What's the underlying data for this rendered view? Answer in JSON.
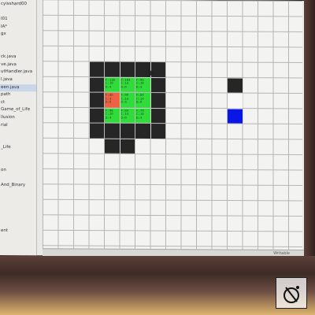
{
  "sidebar": {
    "items": [
      {
        "label": "cyisshard00",
        "selected": false
      },
      {
        "label": "",
        "selected": false
      },
      {
        "label": "I01",
        "selected": false
      },
      {
        "label": "IA*",
        "selected": false
      },
      {
        "label": "gx",
        "selected": false
      },
      {
        "label": "",
        "selected": false
      },
      {
        "label": "",
        "selected": false
      },
      {
        "label": "ck.java",
        "selected": false
      },
      {
        "label": "ve.java",
        "selected": false
      },
      {
        "label": "utHandler.java",
        "selected": false
      },
      {
        "label": "l.java",
        "selected": false
      },
      {
        "label": "een.java",
        "selected": true
      },
      {
        "label": "path",
        "selected": false
      },
      {
        "label": "ct",
        "selected": false
      },
      {
        "label": "Game_of_Life",
        "selected": false
      },
      {
        "label": "llusion",
        "selected": false
      },
      {
        "label": "rial",
        "selected": false
      },
      {
        "label": "",
        "selected": false
      },
      {
        "label": "",
        "selected": false
      },
      {
        "label": "_Life",
        "selected": false
      },
      {
        "label": "",
        "selected": false
      },
      {
        "label": "",
        "selected": false
      },
      {
        "label": "on",
        "selected": false
      },
      {
        "label": "",
        "selected": false
      },
      {
        "label": "And_Binary",
        "selected": false
      },
      {
        "label": "",
        "selected": false
      },
      {
        "label": "",
        "selected": false
      },
      {
        "label": "",
        "selected": false
      },
      {
        "label": "",
        "selected": false
      },
      {
        "label": "",
        "selected": false
      },
      {
        "label": "ent",
        "selected": false
      },
      {
        "label": "",
        "selected": false
      },
      {
        "label": "",
        "selected": false
      }
    ]
  },
  "grid": {
    "cells": [
      {
        "kind": "dark",
        "row": 4,
        "col": 3,
        "label": ""
      },
      {
        "kind": "dark",
        "row": 4,
        "col": 4,
        "label": ""
      },
      {
        "kind": "dark",
        "row": 4,
        "col": 5,
        "label": ""
      },
      {
        "kind": "dark",
        "row": 4,
        "col": 6,
        "label": ""
      },
      {
        "kind": "dark",
        "row": 4,
        "col": 7,
        "label": ""
      },
      {
        "kind": "dark",
        "row": 5,
        "col": 3,
        "label": ""
      },
      {
        "kind": "green",
        "row": 5,
        "col": 4,
        "label": "F:138\nC:10\nD:4"
      },
      {
        "kind": "green",
        "row": 5,
        "col": 5,
        "label": "F:104\nC:14\nD:0"
      },
      {
        "kind": "green",
        "row": 5,
        "col": 6,
        "label": "F:96\nC:10\nD:4"
      },
      {
        "kind": "dark",
        "row": 5,
        "col": 7,
        "label": ""
      },
      {
        "kind": "dark",
        "row": 6,
        "col": 3,
        "label": ""
      },
      {
        "kind": "red",
        "row": 6,
        "col": 4,
        "label": "F:86\nC:4\nD:0"
      },
      {
        "kind": "green",
        "row": 6,
        "col": 5,
        "label": "F:90\nC:14\nD:4"
      },
      {
        "kind": "green",
        "row": 6,
        "col": 6,
        "label": "F:84\nC:14\nD:0"
      },
      {
        "kind": "dark",
        "row": 6,
        "col": 7,
        "label": ""
      },
      {
        "kind": "dark",
        "row": 7,
        "col": 3,
        "label": ""
      },
      {
        "kind": "green",
        "row": 7,
        "col": 4,
        "label": "F:96\nC:20\nD:4"
      },
      {
        "kind": "green",
        "row": 7,
        "col": 5,
        "label": "F:84\nC:14\nD:0"
      },
      {
        "kind": "green",
        "row": 7,
        "col": 6,
        "label": "F:70\nC:18\nD:4"
      },
      {
        "kind": "dark",
        "row": 7,
        "col": 7,
        "label": ""
      },
      {
        "kind": "dark",
        "row": 8,
        "col": 3,
        "label": ""
      },
      {
        "kind": "dark",
        "row": 8,
        "col": 4,
        "label": ""
      },
      {
        "kind": "dark",
        "row": 8,
        "col": 5,
        "label": ""
      },
      {
        "kind": "dark",
        "row": 8,
        "col": 6,
        "label": ""
      },
      {
        "kind": "dark",
        "row": 8,
        "col": 7,
        "label": ""
      },
      {
        "kind": "dark",
        "row": 9,
        "col": 4,
        "label": ""
      },
      {
        "kind": "dark",
        "row": 9,
        "col": 5,
        "label": ""
      },
      {
        "kind": "dark",
        "row": 5,
        "col": 12,
        "label": ""
      },
      {
        "kind": "white",
        "row": 6,
        "col": 12,
        "label": ""
      },
      {
        "kind": "blue",
        "row": 7,
        "col": 12,
        "label": ""
      }
    ]
  },
  "status": {
    "text": "Writable"
  },
  "colors": {
    "wall": "#262626",
    "open": "#2fdc3a",
    "current": "#ef6144",
    "goal": "#0a16e6"
  },
  "watermark": {
    "icon": "photo-watermark-icon"
  }
}
